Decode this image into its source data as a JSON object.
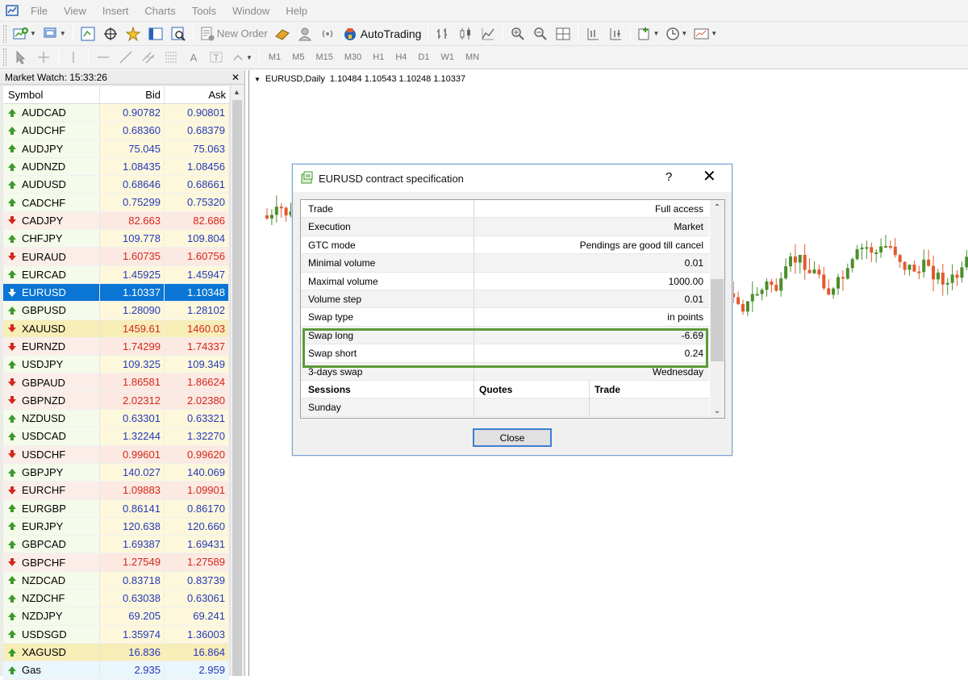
{
  "menu": [
    "File",
    "View",
    "Insert",
    "Charts",
    "Tools",
    "Window",
    "Help"
  ],
  "toolbar": {
    "new_order": "New Order",
    "autotrading": "AutoTrading",
    "timeframes": [
      "M1",
      "M5",
      "M15",
      "M30",
      "H1",
      "H4",
      "D1",
      "W1",
      "MN"
    ],
    "text_tool": "A"
  },
  "market_watch": {
    "title": "Market Watch: 15:33:26",
    "headers": {
      "symbol": "Symbol",
      "bid": "Bid",
      "ask": "Ask"
    },
    "rows": [
      {
        "symbol": "AUDCAD",
        "bid": "0.90782",
        "ask": "0.90801",
        "dir": "up",
        "style": ""
      },
      {
        "symbol": "AUDCHF",
        "bid": "0.68360",
        "ask": "0.68379",
        "dir": "up",
        "style": ""
      },
      {
        "symbol": "AUDJPY",
        "bid": "75.045",
        "ask": "75.063",
        "dir": "up",
        "style": ""
      },
      {
        "symbol": "AUDNZD",
        "bid": "1.08435",
        "ask": "1.08456",
        "dir": "up",
        "style": ""
      },
      {
        "symbol": "AUDUSD",
        "bid": "0.68646",
        "ask": "0.68661",
        "dir": "up",
        "style": "pinkrow"
      },
      {
        "symbol": "CADCHF",
        "bid": "0.75299",
        "ask": "0.75320",
        "dir": "up",
        "style": ""
      },
      {
        "symbol": "CADJPY",
        "bid": "82.663",
        "ask": "82.686",
        "dir": "down",
        "style": ""
      },
      {
        "symbol": "CHFJPY",
        "bid": "109.778",
        "ask": "109.804",
        "dir": "up",
        "style": ""
      },
      {
        "symbol": "EURAUD",
        "bid": "1.60735",
        "ask": "1.60756",
        "dir": "down",
        "style": ""
      },
      {
        "symbol": "EURCAD",
        "bid": "1.45925",
        "ask": "1.45947",
        "dir": "up",
        "style": ""
      },
      {
        "symbol": "EURUSD",
        "bid": "1.10337",
        "ask": "1.10348",
        "dir": "down",
        "style": "sel"
      },
      {
        "symbol": "GBPUSD",
        "bid": "1.28090",
        "ask": "1.28102",
        "dir": "up",
        "style": "pinkrow"
      },
      {
        "symbol": "XAUUSD",
        "bid": "1459.61",
        "ask": "1460.03",
        "dir": "down",
        "style": "gold"
      },
      {
        "symbol": "EURNZD",
        "bid": "1.74299",
        "ask": "1.74337",
        "dir": "down",
        "style": ""
      },
      {
        "symbol": "USDJPY",
        "bid": "109.325",
        "ask": "109.349",
        "dir": "up",
        "style": "pinkrow"
      },
      {
        "symbol": "GBPAUD",
        "bid": "1.86581",
        "ask": "1.86624",
        "dir": "down",
        "style": ""
      },
      {
        "symbol": "GBPNZD",
        "bid": "2.02312",
        "ask": "2.02380",
        "dir": "down",
        "style": ""
      },
      {
        "symbol": "NZDUSD",
        "bid": "0.63301",
        "ask": "0.63321",
        "dir": "up",
        "style": "pinkrow"
      },
      {
        "symbol": "USDCAD",
        "bid": "1.32244",
        "ask": "1.32270",
        "dir": "up",
        "style": "pinkrow"
      },
      {
        "symbol": "USDCHF",
        "bid": "0.99601",
        "ask": "0.99620",
        "dir": "down",
        "style": "pinkrow"
      },
      {
        "symbol": "GBPJPY",
        "bid": "140.027",
        "ask": "140.069",
        "dir": "up",
        "style": ""
      },
      {
        "symbol": "EURCHF",
        "bid": "1.09883",
        "ask": "1.09901",
        "dir": "down",
        "style": ""
      },
      {
        "symbol": "EURGBP",
        "bid": "0.86141",
        "ask": "0.86170",
        "dir": "up",
        "style": ""
      },
      {
        "symbol": "EURJPY",
        "bid": "120.638",
        "ask": "120.660",
        "dir": "up",
        "style": ""
      },
      {
        "symbol": "GBPCAD",
        "bid": "1.69387",
        "ask": "1.69431",
        "dir": "up",
        "style": ""
      },
      {
        "symbol": "GBPCHF",
        "bid": "1.27549",
        "ask": "1.27589",
        "dir": "down",
        "style": ""
      },
      {
        "symbol": "NZDCAD",
        "bid": "0.83718",
        "ask": "0.83739",
        "dir": "up",
        "style": ""
      },
      {
        "symbol": "NZDCHF",
        "bid": "0.63038",
        "ask": "0.63061",
        "dir": "up",
        "style": ""
      },
      {
        "symbol": "NZDJPY",
        "bid": "69.205",
        "ask": "69.241",
        "dir": "up",
        "style": ""
      },
      {
        "symbol": "USDSGD",
        "bid": "1.35974",
        "ask": "1.36003",
        "dir": "up",
        "style": ""
      },
      {
        "symbol": "XAGUSD",
        "bid": "16.836",
        "ask": "16.864",
        "dir": "up",
        "style": "silver"
      },
      {
        "symbol": "Gas",
        "bid": "2.935",
        "ask": "2.959",
        "dir": "up",
        "style": "gas"
      }
    ]
  },
  "chart": {
    "symbol_tf": "EURUSD,Daily",
    "ohlc": "1.10484 1.10543 1.10248 1.10337",
    "colors": {
      "bull": "#4a8f2b",
      "bear": "#e25a2f"
    }
  },
  "dialog": {
    "title": "EURUSD contract specification",
    "help": "?",
    "close_x": "✕",
    "rows": [
      {
        "k": "Trade",
        "v": "Full access"
      },
      {
        "k": "Execution",
        "v": "Market"
      },
      {
        "k": "GTC mode",
        "v": "Pendings are good till cancel"
      },
      {
        "k": "Minimal volume",
        "v": "0.01"
      },
      {
        "k": "Maximal volume",
        "v": "1000.00"
      },
      {
        "k": "Volume step",
        "v": "0.01"
      },
      {
        "k": "Swap type",
        "v": "in points"
      },
      {
        "k": "Swap long",
        "v": "-6.69"
      },
      {
        "k": "Swap short",
        "v": "0.24"
      },
      {
        "k": "3-days swap",
        "v": "Wednesday"
      }
    ],
    "sessions_header": {
      "c1": "Sessions",
      "c2": "Quotes",
      "c3": "Trade"
    },
    "sunday": "Sunday",
    "close_button": "Close",
    "highlight_color": "#5c9a36"
  }
}
